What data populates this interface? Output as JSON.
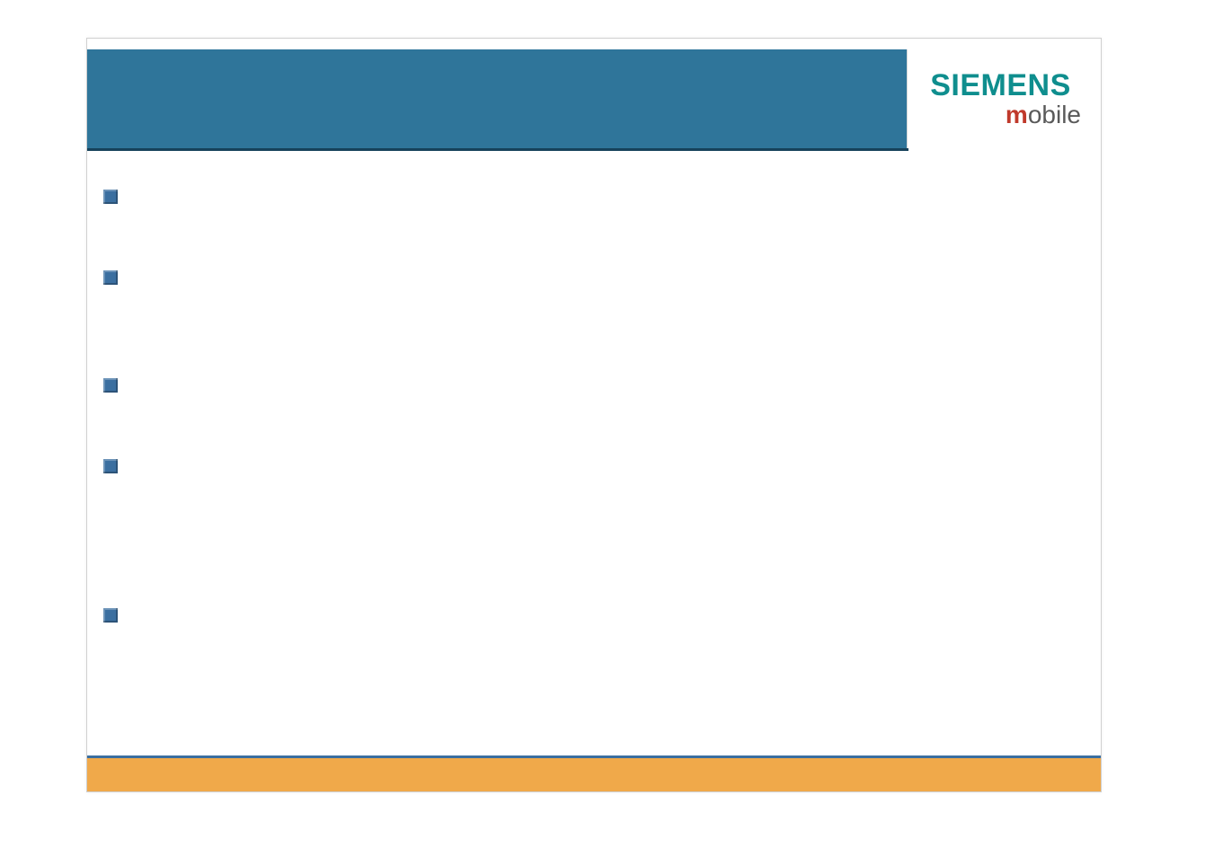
{
  "logo": {
    "brand": "SIEMENS",
    "sub_m": "m",
    "sub_rest": "obile"
  },
  "bullets": [
    {
      "text": ""
    },
    {
      "text": ""
    },
    {
      "text": ""
    },
    {
      "text": ""
    },
    {
      "text": ""
    }
  ],
  "colors": {
    "header": "#2f759a",
    "footer": "#f0a94a",
    "bullet": "#3b6fa0",
    "brand": "#0f8e8e",
    "accent_red": "#c0392b"
  }
}
